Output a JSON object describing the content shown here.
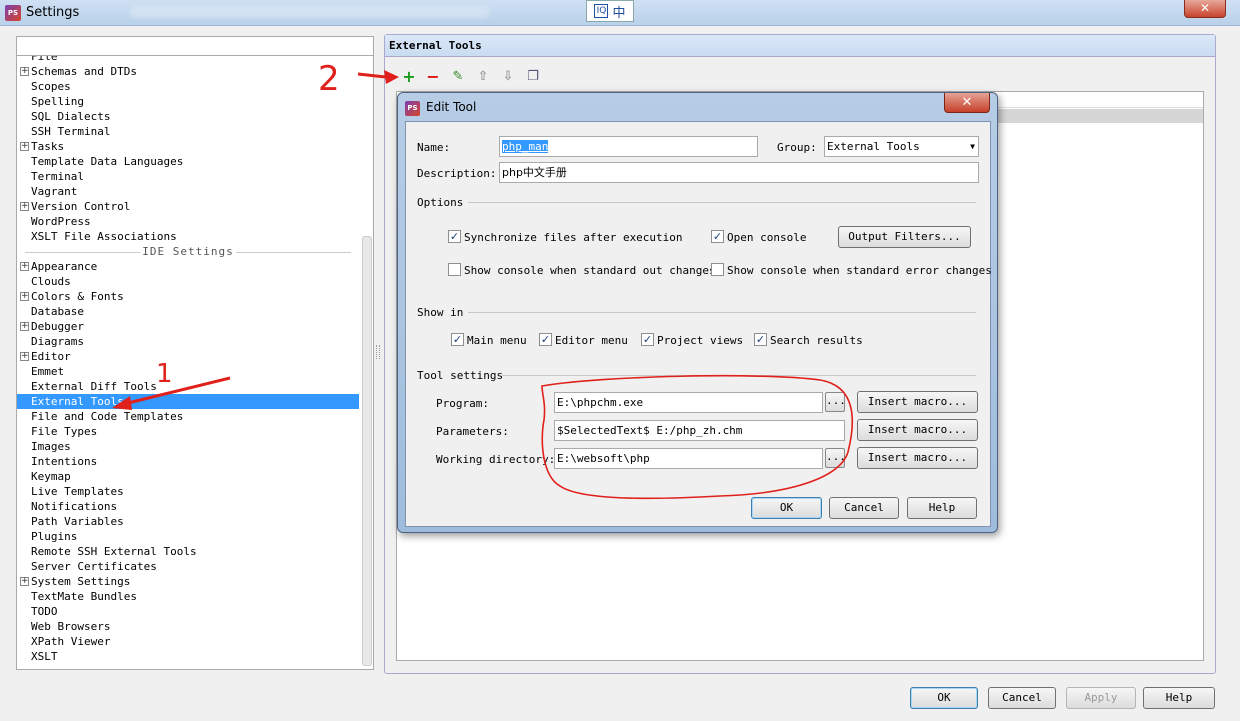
{
  "window": {
    "title": "Settings",
    "close": "✕"
  },
  "ime": {
    "box": "IQ",
    "char": "中"
  },
  "tree": {
    "items": [
      {
        "label": "File",
        "exp": ""
      },
      {
        "label": "Schemas and DTDs",
        "exp": "+"
      },
      {
        "label": "Scopes",
        "exp": ""
      },
      {
        "label": "Spelling",
        "exp": ""
      },
      {
        "label": "SQL Dialects",
        "exp": ""
      },
      {
        "label": "SSH Terminal",
        "exp": ""
      },
      {
        "label": "Tasks",
        "exp": "+"
      },
      {
        "label": "Template Data Languages",
        "exp": ""
      },
      {
        "label": "Terminal",
        "exp": ""
      },
      {
        "label": "Vagrant",
        "exp": ""
      },
      {
        "label": "Version Control",
        "exp": "+"
      },
      {
        "label": "WordPress",
        "exp": ""
      },
      {
        "label": "XSLT File Associations",
        "exp": ""
      }
    ],
    "section": "IDE Settings",
    "ide_items": [
      {
        "label": "Appearance",
        "exp": "+"
      },
      {
        "label": "Clouds",
        "exp": ""
      },
      {
        "label": "Colors & Fonts",
        "exp": "+"
      },
      {
        "label": "Database",
        "exp": ""
      },
      {
        "label": "Debugger",
        "exp": "+"
      },
      {
        "label": "Diagrams",
        "exp": ""
      },
      {
        "label": "Editor",
        "exp": "+"
      },
      {
        "label": "Emmet",
        "exp": ""
      },
      {
        "label": "External Diff Tools",
        "exp": ""
      },
      {
        "label": "External Tools",
        "exp": "",
        "selected": true
      },
      {
        "label": "File and Code Templates",
        "exp": ""
      },
      {
        "label": "File Types",
        "exp": ""
      },
      {
        "label": "Images",
        "exp": ""
      },
      {
        "label": "Intentions",
        "exp": ""
      },
      {
        "label": "Keymap",
        "exp": ""
      },
      {
        "label": "Live Templates",
        "exp": ""
      },
      {
        "label": "Notifications",
        "exp": ""
      },
      {
        "label": "Path Variables",
        "exp": ""
      },
      {
        "label": "Plugins",
        "exp": ""
      },
      {
        "label": "Remote SSH External Tools",
        "exp": ""
      },
      {
        "label": "Server Certificates",
        "exp": ""
      },
      {
        "label": "System Settings",
        "exp": "+"
      },
      {
        "label": "TextMate Bundles",
        "exp": ""
      },
      {
        "label": "TODO",
        "exp": ""
      },
      {
        "label": "Web Browsers",
        "exp": ""
      },
      {
        "label": "XPath Viewer",
        "exp": ""
      },
      {
        "label": "XSLT",
        "exp": ""
      }
    ]
  },
  "panel": {
    "title": "External Tools",
    "toolbar": {
      "add": "+",
      "remove": "−",
      "edit": "✎",
      "up": "⇧",
      "down": "⇩",
      "copy": "❐"
    }
  },
  "dialog": {
    "title": "Edit Tool",
    "close": "✕",
    "name_label": "Name:",
    "name_value": "php_man",
    "group_label": "Group:",
    "group_value": "External Tools",
    "desc_label": "Description:",
    "desc_value": "php中文手册",
    "options": {
      "title": "Options",
      "sync": "Synchronize files after execution",
      "open_console": "Open console",
      "output_filters": "Output Filters...",
      "show_console_out": "Show console when standard out changes",
      "show_console_err": "Show console when standard error changes"
    },
    "show_in": {
      "title": "Show in",
      "main_menu": "Main menu",
      "editor_menu": "Editor menu",
      "project_views": "Project views",
      "search_results": "Search results"
    },
    "tool_settings": {
      "title": "Tool settings",
      "program_label": "Program:",
      "program_value": "E:\\phpchm.exe",
      "params_label": "Parameters:",
      "params_value": "$SelectedText$ E:/php_zh.chm",
      "workdir_label": "Working directory:",
      "workdir_value": "E:\\websoft\\php",
      "insert_macro": "Insert macro...",
      "browse": "..."
    },
    "buttons": {
      "ok": "OK",
      "cancel": "Cancel",
      "help": "Help"
    }
  },
  "footer": {
    "ok": "OK",
    "cancel": "Cancel",
    "apply": "Apply",
    "help": "Help"
  },
  "annotations": {
    "marker_1": "1",
    "marker_2": "2",
    "color": "#e0201b"
  }
}
